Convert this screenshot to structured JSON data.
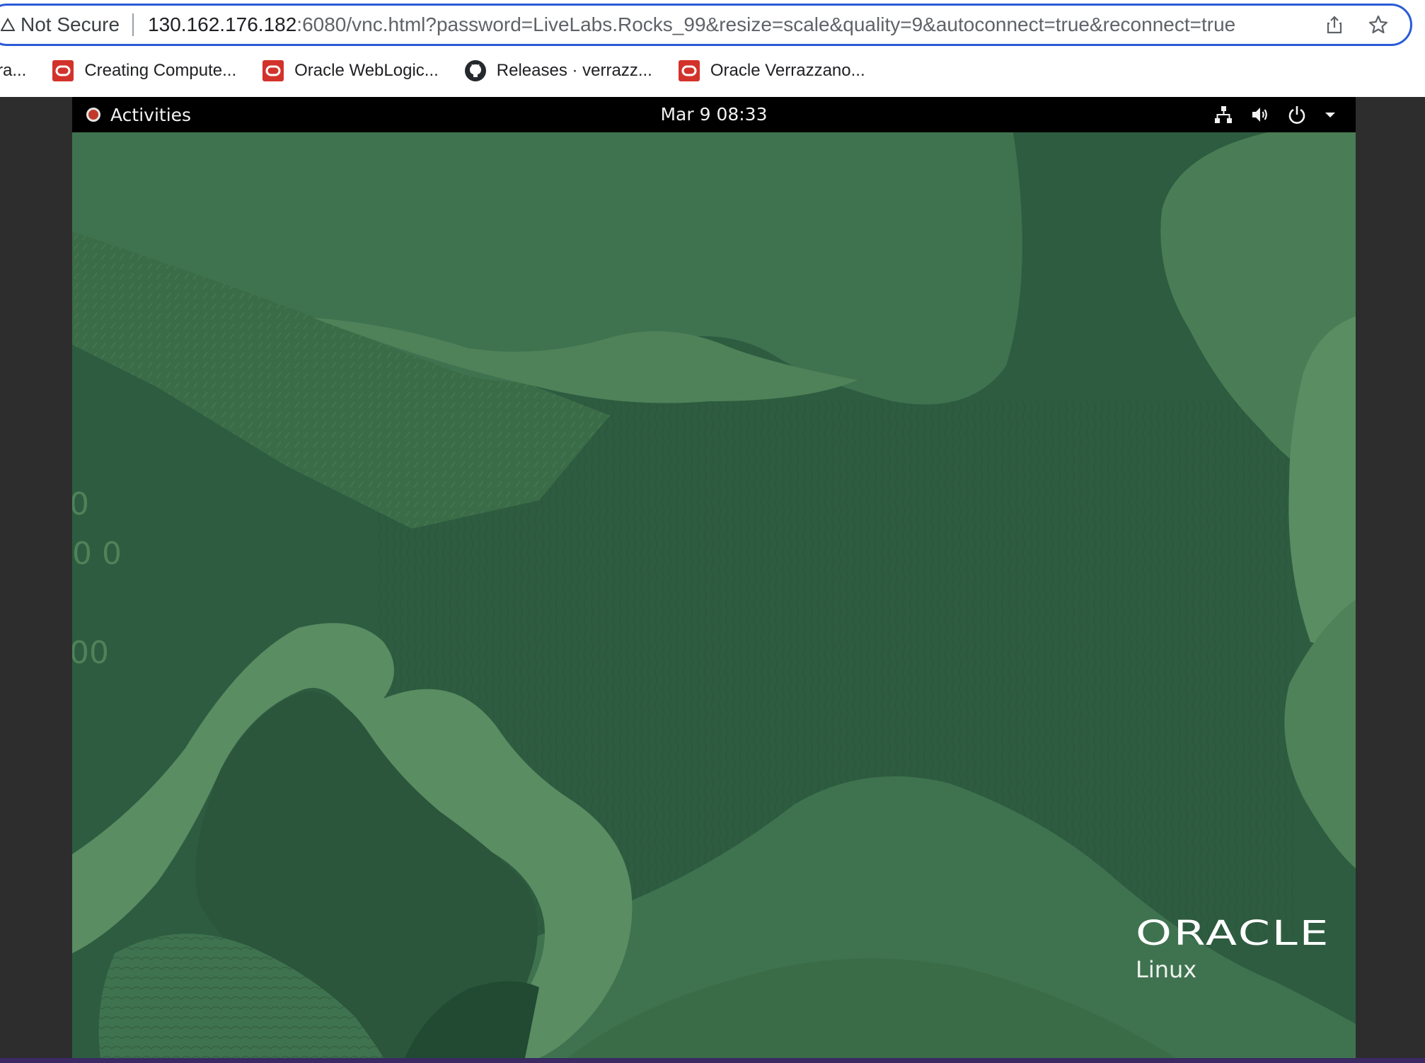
{
  "browser": {
    "security_label": "Not Secure",
    "url_host": "130.162.176.182",
    "url_rest": ":6080/vnc.html?password=LiveLabs.Rocks_99&resize=scale&quality=9&autoconnect=true&reconnect=true",
    "icons": [
      "warning-icon",
      "share-icon",
      "star-icon"
    ]
  },
  "bookmarks": [
    {
      "label": "ra...",
      "icon": "none"
    },
    {
      "label": "Creating Compute...",
      "icon": "oracle-icon"
    },
    {
      "label": "Oracle WebLogic...",
      "icon": "oracle-icon"
    },
    {
      "label": "Releases · verrazz...",
      "icon": "github-icon"
    },
    {
      "label": "Oracle Verrazzano...",
      "icon": "oracle-icon"
    }
  ],
  "gnome_panel": {
    "activities_label": "Activities",
    "clock": "Mar 9  08:33",
    "tray_icons": [
      "network-icon",
      "volume-icon",
      "power-icon",
      "chevron-down-icon"
    ]
  },
  "desktop": {
    "logo_text": "ORACLE",
    "logo_subtext": "Linux",
    "wallpaper_colors": {
      "base": "#2e5c40",
      "mid": "#3f7350",
      "light": "#5a8d62",
      "dark": "#264f37"
    }
  }
}
